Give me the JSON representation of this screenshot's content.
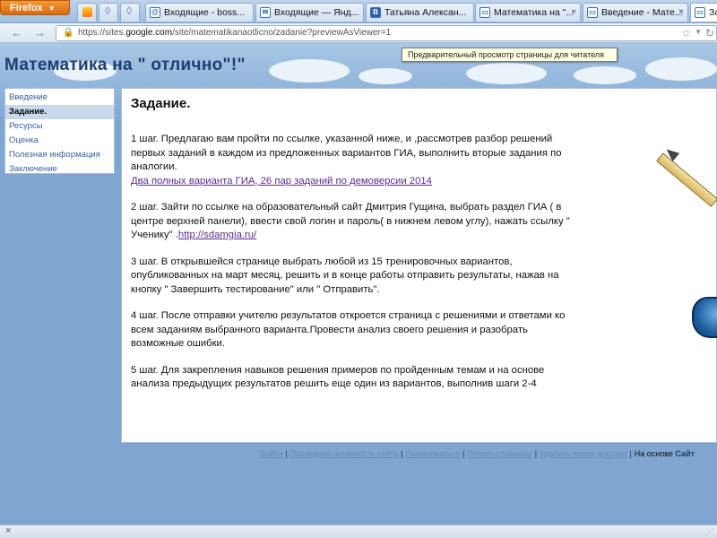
{
  "browser": {
    "menu_button": "Firefox",
    "tabs": [
      {
        "label": "Входящие - boss..."
      },
      {
        "label": "Входящие — Янд..."
      },
      {
        "label": "Татьяна Алексан..."
      },
      {
        "label": "Математика на \"..."
      },
      {
        "label": "Введение - Мате..."
      },
      {
        "label": "Зад"
      }
    ],
    "url": {
      "prefix": "https://sites.",
      "domain": "google.com",
      "path": "/site/matematikanaotlicno/zadanie?previewAsViewer=1"
    },
    "tooltip": "Предварительный просмотр страницы для читателя"
  },
  "site": {
    "title": "Математика на \" отлично\"!\"",
    "sidebar": {
      "items": [
        {
          "label": "Введение"
        },
        {
          "label": "Задание."
        },
        {
          "label": "Ресурсы"
        },
        {
          "label": "Оценка"
        },
        {
          "label": "Полезная информация"
        },
        {
          "label": "Заключение"
        }
      ]
    },
    "content": {
      "heading": "Задание.",
      "step1_text": "1 шаг. Предлагаю вам пройти по ссылке, указанной ниже, и ,рассмотрев разбор решений первых заданий в каждом из предложенных вариантов ГИА, выполнить вторые задания по аналогии.",
      "step1_link": "Два полных варианта ГИА, 26 пар заданий по демоверсии 2014",
      "step2_text": "2 шаг. Зайти по ссылке на образовательный сайт Дмитрия Гущина, выбрать раздел ГИА ( в центре верхней панели), ввести свой логин и пароль( в нижнем левом углу), нажать ссылку \" Ученику\" .",
      "step2_link": "http://sdamgia.ru/",
      "step3_text": "3 шаг. В открывшейся странице выбрать любой из 15 тренировочных вариантов, опубликованных на март месяц, решить и в конце работы отправить результаты, нажав на кнопку \" Завершить тестирование\" или \" Отправить\".",
      "step4_text": "4 шаг. После отправки учителю результатов  откроется страница с решениями и ответами ко всем заданиям выбранного варианта.Провести анализ своего решения и разобрать возможные ошибки.",
      "step5_text": "5 шаг. Для закрепления навыков решения примеров по пройденным темам и на основе анализа предыдущих результатов решить еще один из вариантов, выполнив шаги 2-4"
    },
    "footer": {
      "links": [
        {
          "label": "Войти"
        },
        {
          "label": "Последняя активность сайта"
        },
        {
          "label": "Пожаловаться"
        },
        {
          "label": "Печать страницы"
        },
        {
          "label": "Удалить право доступа"
        }
      ],
      "powered_text": "На основе",
      "powered_brand": "Сайт"
    }
  }
}
